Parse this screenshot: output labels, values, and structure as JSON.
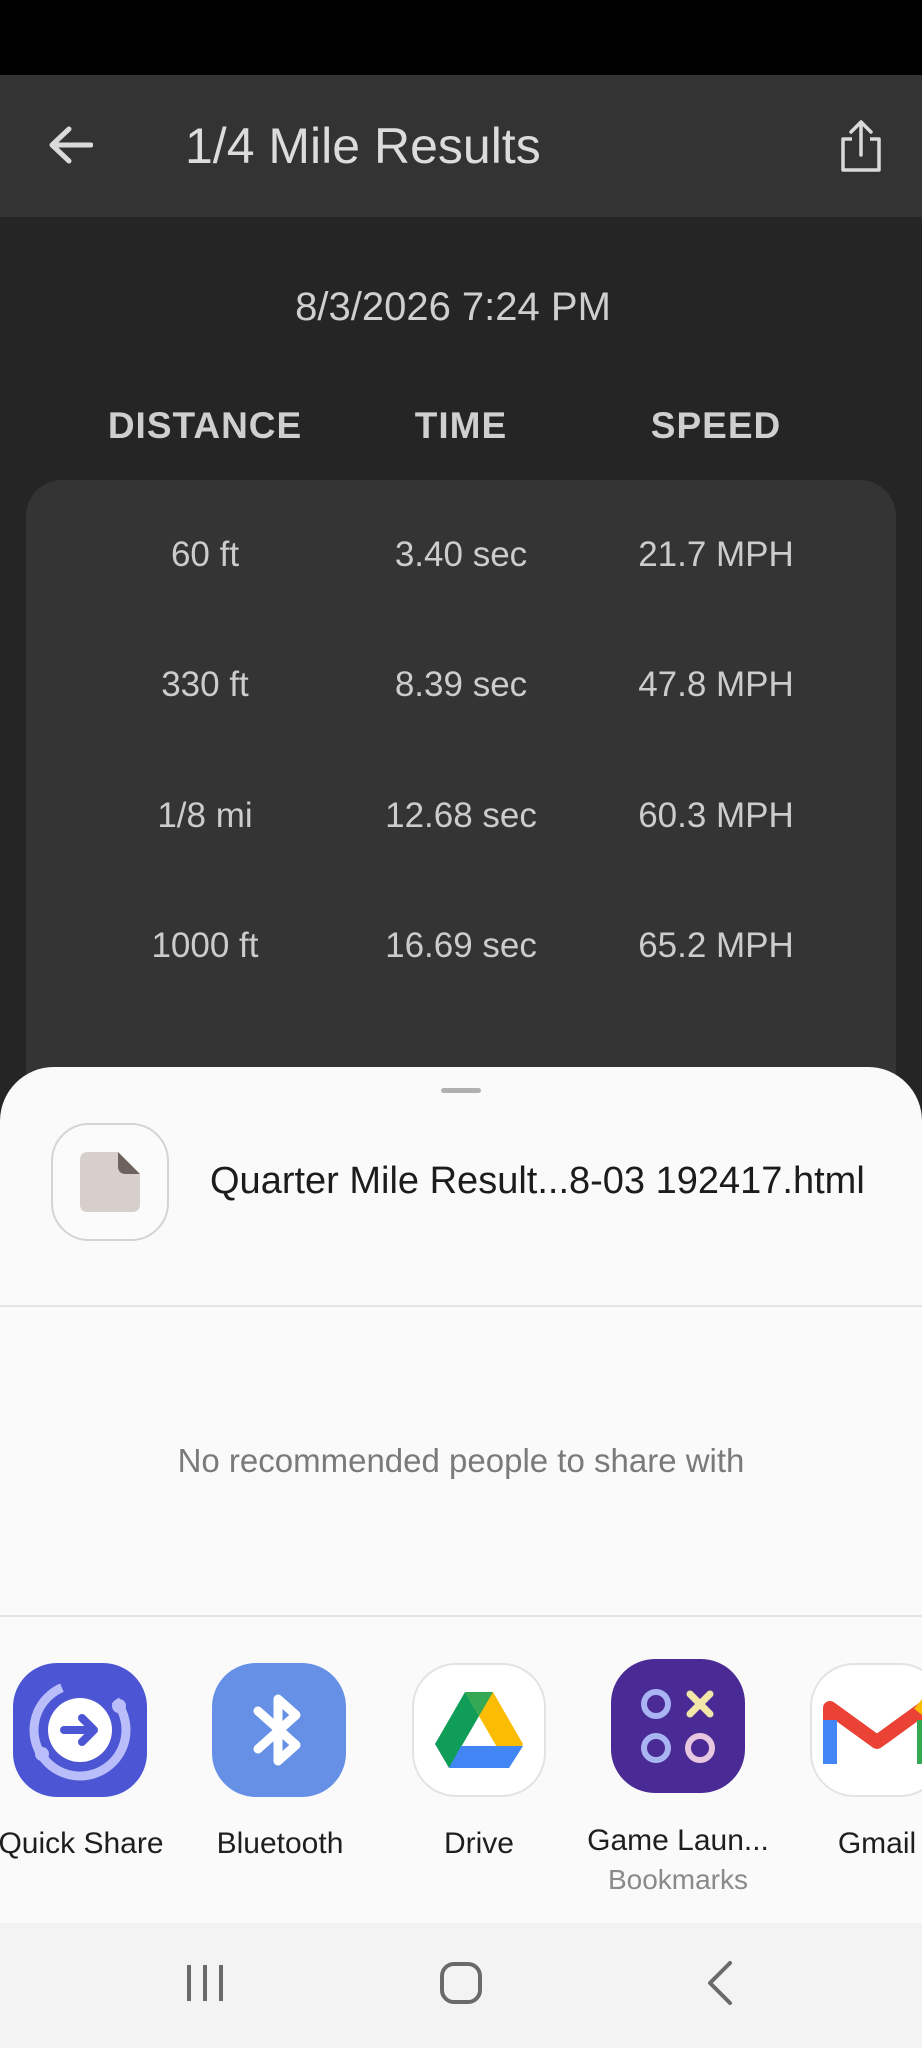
{
  "app_bar": {
    "title": "1/4 Mile Results",
    "back_icon": "arrow-left-icon",
    "share_icon": "share-icon"
  },
  "results": {
    "date": "8/3/2026 7:24 PM",
    "headers": {
      "distance": "DISTANCE",
      "time": "TIME",
      "speed": "SPEED"
    },
    "rows": [
      {
        "distance": "60 ft",
        "time": "3.40 sec",
        "speed": "21.7 MPH"
      },
      {
        "distance": "330 ft",
        "time": "8.39 sec",
        "speed": "47.8 MPH"
      },
      {
        "distance": "1/8 mi",
        "time": "12.68 sec",
        "speed": "60.3 MPH"
      },
      {
        "distance": "1000 ft",
        "time": "16.69 sec",
        "speed": "65.2 MPH"
      }
    ]
  },
  "share_sheet": {
    "file_name": "Quarter Mile Result...8-03 192417.html",
    "file_icon": "document-icon",
    "no_recommendations": "No recommended people to share with",
    "apps": [
      {
        "label": "Quick Share",
        "sublabel": "",
        "icon": "quick-share-icon",
        "color": "#4c55d4"
      },
      {
        "label": "Bluetooth",
        "sublabel": "",
        "icon": "bluetooth-icon",
        "color": "#6690e6"
      },
      {
        "label": "Drive",
        "sublabel": "",
        "icon": "drive-icon",
        "color": "#ffffff"
      },
      {
        "label": "Game Laun...",
        "sublabel": "Bookmarks",
        "icon": "game-launcher-icon",
        "color": "#4a2a94"
      },
      {
        "label": "Gmail",
        "sublabel": "",
        "icon": "gmail-icon",
        "color": "#ffffff"
      }
    ]
  },
  "nav_bar": {
    "recents_icon": "recents-icon",
    "home_icon": "home-icon",
    "back_icon": "nav-back-icon"
  }
}
